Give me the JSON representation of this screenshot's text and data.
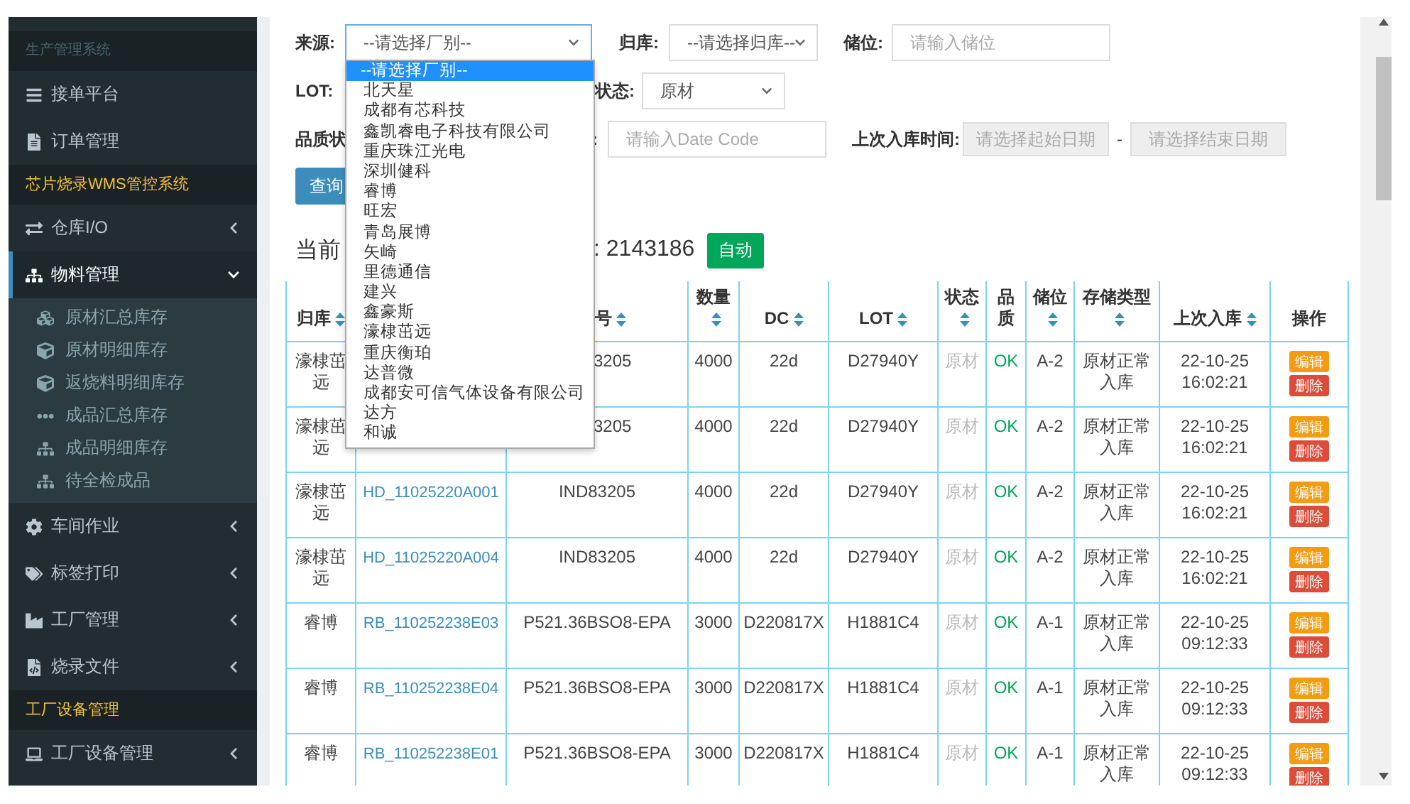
{
  "sidebar": {
    "header": "生产管理系统",
    "items": [
      {
        "kind": "item",
        "label": "接单平台"
      },
      {
        "kind": "item",
        "label": "订单管理"
      },
      {
        "kind": "section",
        "label": "芯片烧录WMS管控系统"
      },
      {
        "kind": "group",
        "label": "仓库I/O",
        "expanded": false,
        "selected": false
      },
      {
        "kind": "group",
        "label": "物料管理",
        "expanded": true,
        "selected": true,
        "children": [
          {
            "label": "原材汇总库存"
          },
          {
            "label": "原材明细库存"
          },
          {
            "label": "返烧料明细库存"
          },
          {
            "label": "成品汇总库存"
          },
          {
            "label": "成品明细库存"
          },
          {
            "label": "待全检成品"
          }
        ]
      },
      {
        "kind": "group",
        "label": "车间作业",
        "expanded": false,
        "selected": false
      },
      {
        "kind": "group",
        "label": "标签打印",
        "expanded": false,
        "selected": false
      },
      {
        "kind": "group",
        "label": "工厂管理",
        "expanded": false,
        "selected": false
      },
      {
        "kind": "group",
        "label": "烧录文件",
        "expanded": false,
        "selected": false
      },
      {
        "kind": "section",
        "label": "工厂设备管理"
      },
      {
        "kind": "group",
        "label": "工厂设备管理",
        "expanded": false,
        "selected": false
      }
    ]
  },
  "filters": {
    "source": {
      "label": "来源:",
      "value": "--请选择厂别--"
    },
    "warehouse": {
      "label": "归库:",
      "value": "--请选择归库--"
    },
    "location": {
      "label": "储位:",
      "placeholder": "请输入储位"
    },
    "lot": {
      "label": "LOT:"
    },
    "status": {
      "label": "状态:",
      "value": "原材"
    },
    "quality": {
      "label": "品质状"
    },
    "datecode": {
      "label": ":",
      "placeholder": "请输入Date Code"
    },
    "last_in": {
      "label": "上次入库时间:",
      "start": "请选择起始日期",
      "separator": "-",
      "end": "请选择结束日期"
    },
    "query_button": "查询"
  },
  "summary": {
    "label": "当前",
    "total": ": 2143186",
    "auto_button": "自动"
  },
  "source_dropdown": {
    "options": [
      {
        "label": "--请选择厂别--",
        "selected": true
      },
      {
        "label": "北天星",
        "selected": false
      },
      {
        "label": "成都有芯科技",
        "selected": false
      },
      {
        "label": "鑫凯睿电子科技有限公司",
        "selected": false
      },
      {
        "label": "重庆珠江光电",
        "selected": false
      },
      {
        "label": "深圳健科",
        "selected": false
      },
      {
        "label": "睿博",
        "selected": false
      },
      {
        "label": "旺宏",
        "selected": false
      },
      {
        "label": "青岛展博",
        "selected": false
      },
      {
        "label": "矢崎",
        "selected": false
      },
      {
        "label": "里德通信",
        "selected": false
      },
      {
        "label": "建兴",
        "selected": false
      },
      {
        "label": "鑫豪斯",
        "selected": false
      },
      {
        "label": "濠棣茁远",
        "selected": false
      },
      {
        "label": "重庆衡珀",
        "selected": false
      },
      {
        "label": "达普微",
        "selected": false
      },
      {
        "label": "成都安可信气体设备有限公司",
        "selected": false
      },
      {
        "label": "达方",
        "selected": false
      },
      {
        "label": "和诚",
        "selected": false
      }
    ]
  },
  "table": {
    "columns": [
      {
        "label": "归库",
        "sortable": true
      },
      {},
      {
        "label": "号",
        "sortable": true,
        "cut": true
      },
      {
        "label": "数量",
        "sortable": true
      },
      {
        "label": "DC",
        "sortable": true
      },
      {
        "label": "LOT",
        "sortable": true
      },
      {
        "label": "状态",
        "sortable": true
      },
      {
        "label": "品质",
        "sortable": false
      },
      {
        "label": "储位",
        "sortable": true
      },
      {
        "label": "存储类型",
        "sortable": true
      },
      {
        "label": "上次入库",
        "sortable": true
      },
      {
        "label": "操作",
        "sortable": false
      }
    ],
    "rows": [
      {
        "warehouse": "濠棣茁远",
        "model": "3205",
        "model_cut": true,
        "qty": "4000",
        "dc": "22d",
        "lot": "D27940Y",
        "status": "原材",
        "quality": "OK",
        "location": "A-2",
        "storage_type": "原材正常入库",
        "time": "22-10-25 16:02:21",
        "actions": [
          "编辑",
          "删除"
        ]
      },
      {
        "warehouse": "濠棣茁远",
        "model": "3205",
        "model_cut": true,
        "qty": "4000",
        "dc": "22d",
        "lot": "D27940Y",
        "status": "原材",
        "quality": "OK",
        "location": "A-2",
        "storage_type": "原材正常入库",
        "time": "22-10-25 16:02:21",
        "actions": [
          "编辑",
          "删除"
        ]
      },
      {
        "warehouse": "濠棣茁远",
        "barcode": "HD_11025220A001",
        "model": "IND83205",
        "model_cut": false,
        "qty": "4000",
        "dc": "22d",
        "lot": "D27940Y",
        "status": "原材",
        "quality": "OK",
        "location": "A-2",
        "storage_type": "原材正常入库",
        "time": "22-10-25 16:02:21",
        "actions": [
          "编辑",
          "删除"
        ]
      },
      {
        "warehouse": "濠棣茁远",
        "barcode": "HD_11025220A004",
        "model": "IND83205",
        "model_cut": false,
        "qty": "4000",
        "dc": "22d",
        "lot": "D27940Y",
        "status": "原材",
        "quality": "OK",
        "location": "A-2",
        "storage_type": "原材正常入库",
        "time": "22-10-25 16:02:21",
        "actions": [
          "编辑",
          "删除"
        ]
      },
      {
        "warehouse": "睿博",
        "barcode": "RB_110252238E03",
        "model": "P521.36BSO8-EPA",
        "model_cut": false,
        "qty": "3000",
        "dc": "D220817X",
        "lot": "H1881C4",
        "status": "原材",
        "quality": "OK",
        "location": "A-1",
        "storage_type": "原材正常入库",
        "time": "22-10-25 09:12:33",
        "actions": [
          "编辑",
          "删除"
        ]
      },
      {
        "warehouse": "睿博",
        "barcode": "RB_110252238E04",
        "model": "P521.36BSO8-EPA",
        "model_cut": false,
        "qty": "3000",
        "dc": "D220817X",
        "lot": "H1881C4",
        "status": "原材",
        "quality": "OK",
        "location": "A-1",
        "storage_type": "原材正常入库",
        "time": "22-10-25 09:12:33",
        "actions": [
          "编辑",
          "删除"
        ]
      },
      {
        "warehouse": "睿博",
        "barcode": "RB_110252238E01",
        "model": "P521.36BSO8-EPA",
        "model_cut": false,
        "qty": "3000",
        "dc": "D220817X",
        "lot": "H1881C4",
        "status": "原材",
        "quality": "OK",
        "location": "A-1",
        "storage_type": "原材正常入库",
        "time": "22-10-25 09:12:33",
        "actions": [
          "编辑",
          "删除"
        ]
      }
    ]
  }
}
